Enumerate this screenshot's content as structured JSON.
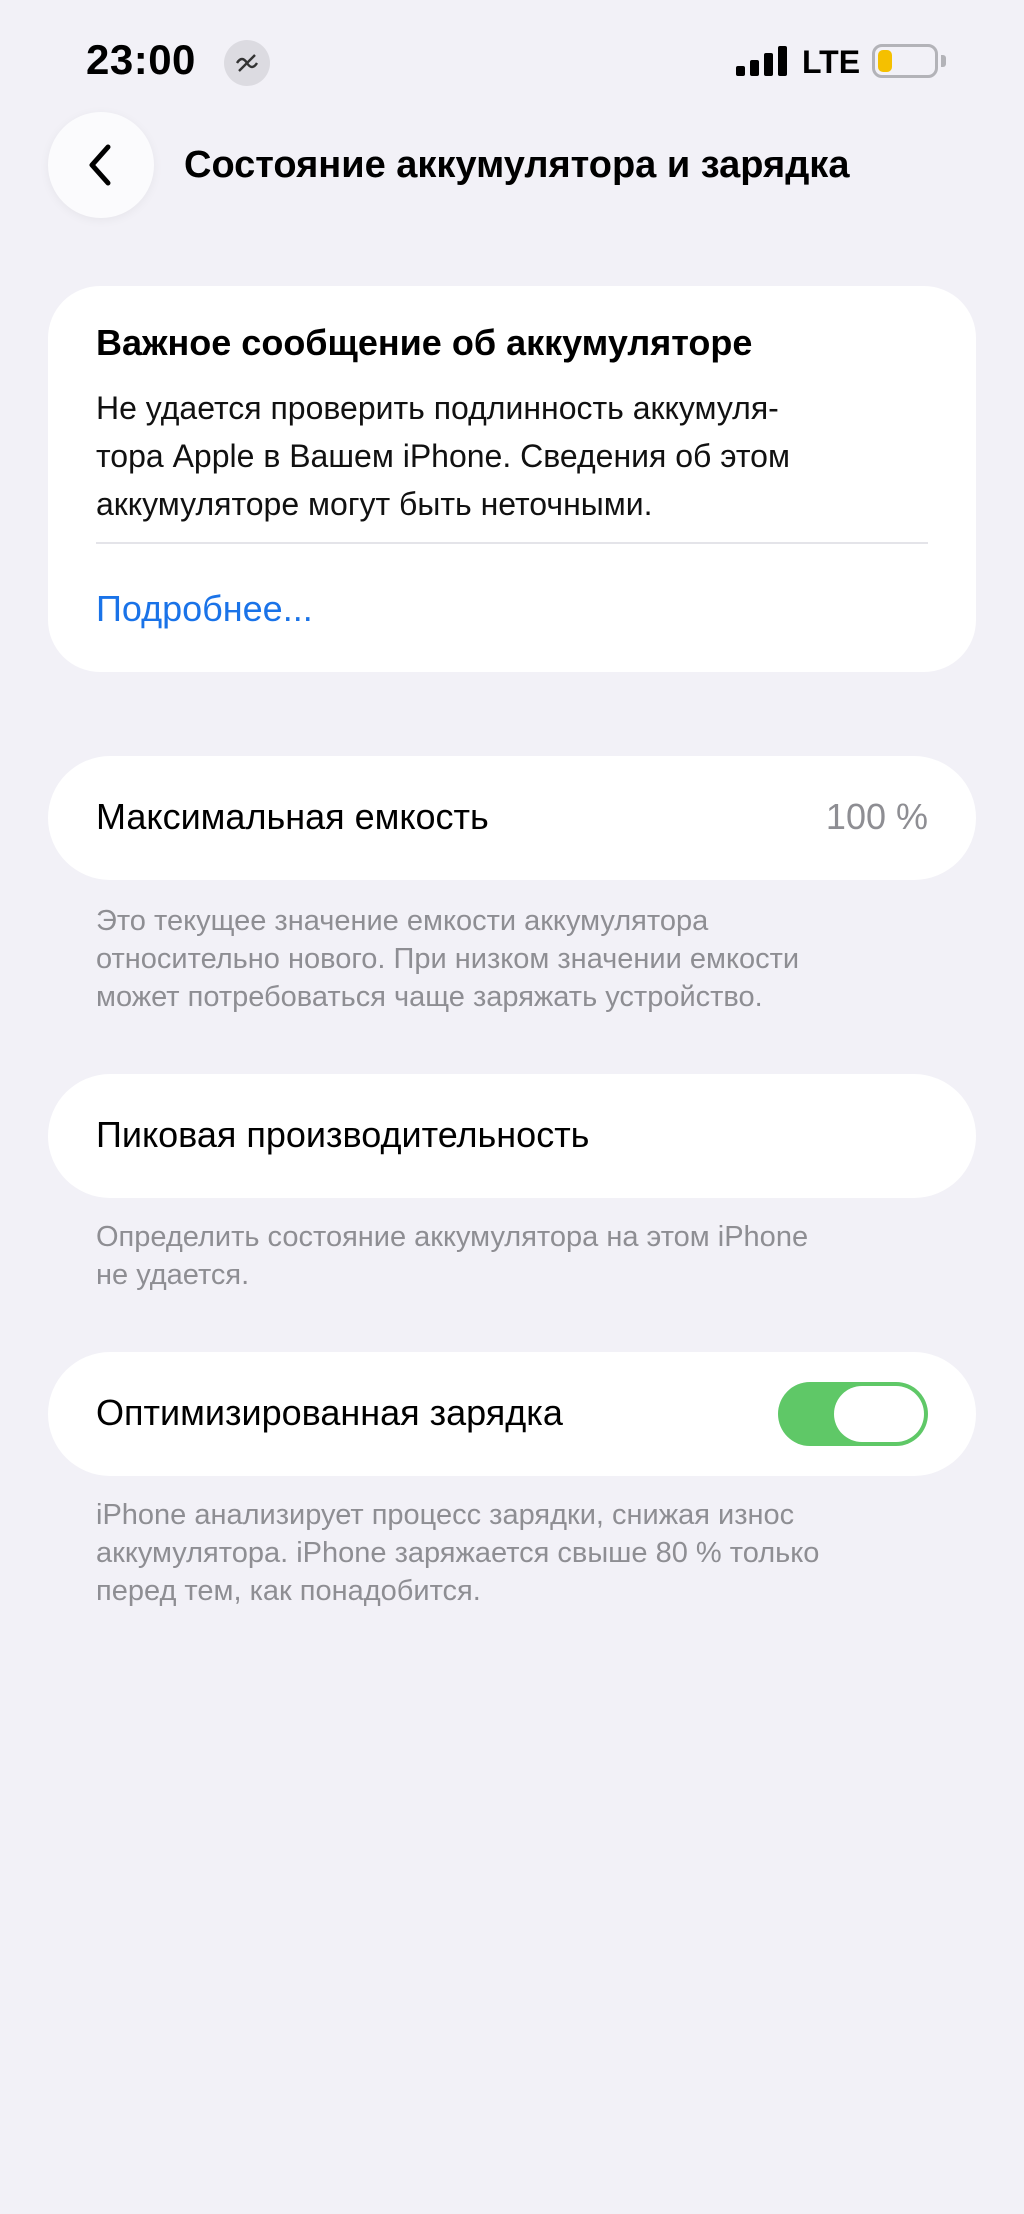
{
  "status_bar": {
    "time": "23:00",
    "focus_icon": "focus-mode-icon",
    "network": "LTE",
    "battery_level_fraction": 0.25,
    "battery_color": "#f5c000"
  },
  "nav": {
    "back_icon": "chevron-left-icon",
    "title": "Состояние аккумулятора и зарядка"
  },
  "alert": {
    "title": "Важное сообщение об аккумуляторе",
    "body_lines": [
      "Не удается проверить подлинность аккумуля-",
      "тора Apple в Вашем iPhone. Сведения об этом",
      "аккумуляторе могут быть неточными."
    ],
    "link": "Подробнее...",
    "link_color": "#1a73e8"
  },
  "capacity": {
    "label": "Максимальная емкость",
    "value": "100 %",
    "note_lines": [
      "Это текущее значение емкости аккумулятора",
      "относительно нового. При низком значении емкости",
      "может потребоваться чаще заряжать устройство."
    ]
  },
  "peak": {
    "label": "Пиковая производительность",
    "note_lines": [
      "Определить состояние аккумулятора на этом iPhone",
      "не удается."
    ]
  },
  "optimized_charging": {
    "label": "Оптимизированная зарядка",
    "enabled": true,
    "toggle_color": "#5fc867",
    "note_lines": [
      "iPhone анализирует процесс зарядки, снижая износ",
      "аккумулятора. iPhone заряжается свыше 80 % только",
      "перед тем, как понадобится."
    ]
  }
}
